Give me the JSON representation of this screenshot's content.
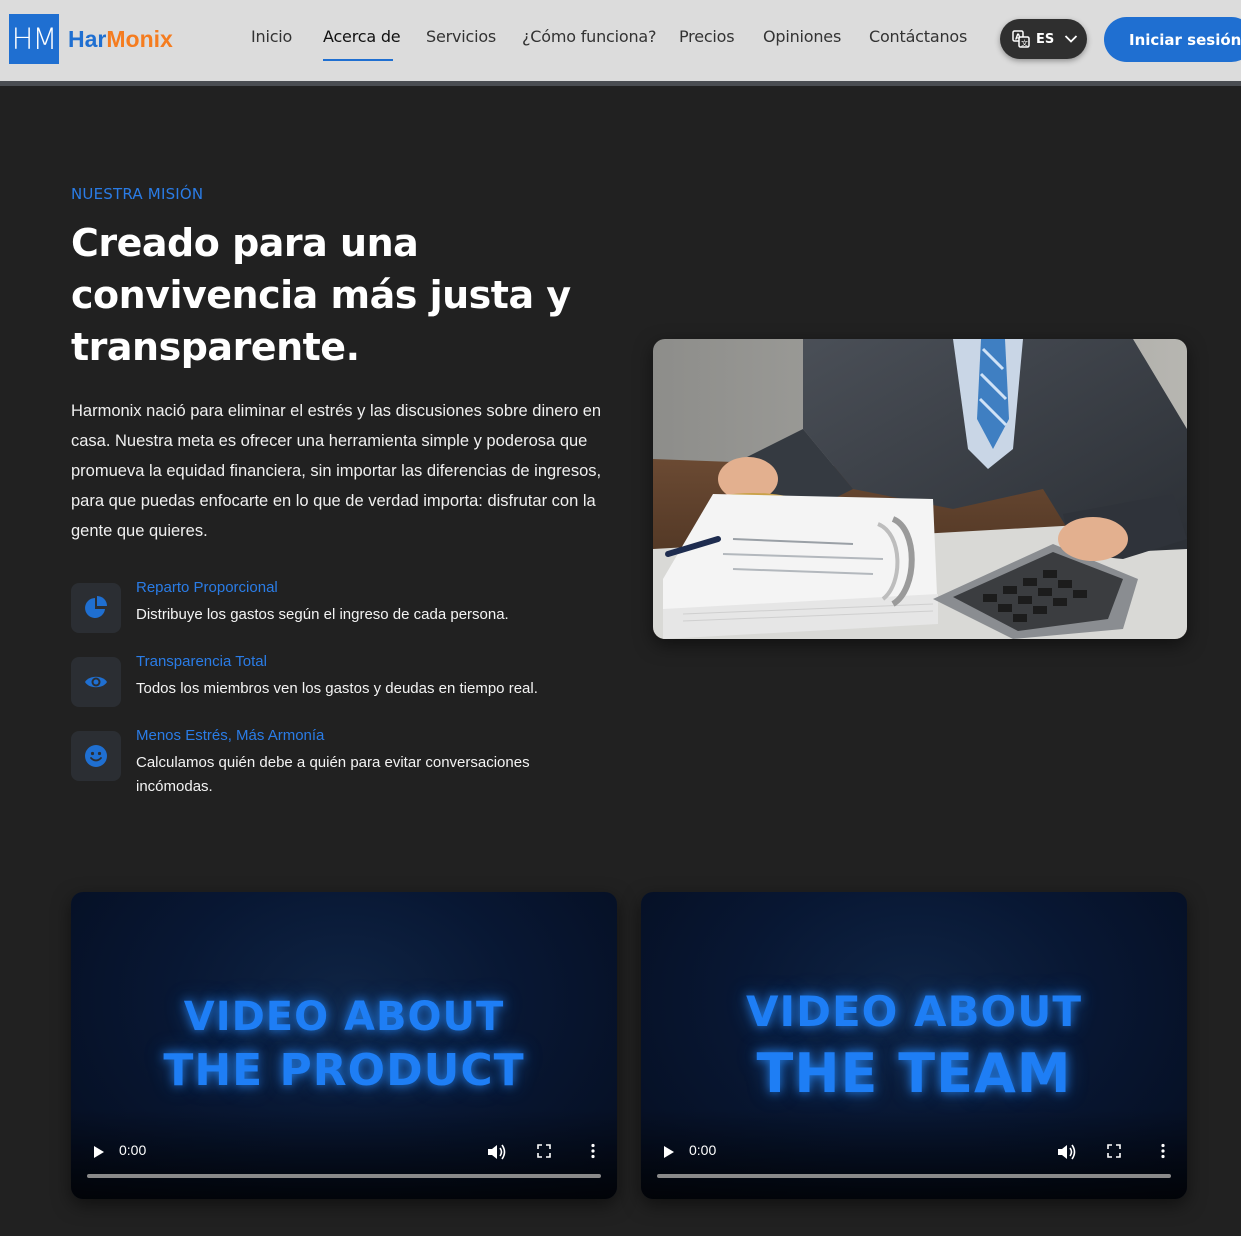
{
  "header": {
    "logo_mark": "HM",
    "brand_part1": "Har",
    "brand_part2": "Monix",
    "nav": [
      {
        "label": "Inicio"
      },
      {
        "label": "Acerca de",
        "active": true
      },
      {
        "label": "Servicios"
      },
      {
        "label": "¿Cómo funciona?"
      },
      {
        "label": "Precios"
      },
      {
        "label": "Opiniones"
      },
      {
        "label": "Contáctanos"
      }
    ],
    "language": "ES",
    "login_label": "Iniciar sesión"
  },
  "mission": {
    "kicker": "NUESTRA MISIÓN",
    "title_line1": "Creado para una",
    "title_line2": "convivencia más justa y",
    "title_line3": "transparente.",
    "description": "Harmonix nació para eliminar el estrés y las discusiones sobre dinero en casa. Nuestra meta es ofrecer una herramienta simple y poderosa que promueva la equidad financiera, sin importar las diferencias de ingresos, para que puedas enfocarte en lo que de verdad importa: disfrutar con la gente que quieres.",
    "features": [
      {
        "icon": "pie-chart-icon",
        "title": "Reparto Proporcional",
        "text": "Distribuye los gastos según el ingreso de cada persona."
      },
      {
        "icon": "eye-icon",
        "title": "Transparencia Total",
        "text": "Todos los miembros ven los gastos y deudas en tiempo real."
      },
      {
        "icon": "smiley-icon",
        "title": "Menos Estrés, Más Armonía",
        "text": "Calculamos quién debe a quién para evitar conversaciones incómodas."
      }
    ]
  },
  "videos": [
    {
      "line1": "VIDEO ABOUT",
      "line2": "THE PRODUCT",
      "time": "0:00"
    },
    {
      "line1": "VIDEO ABOUT",
      "line2": "THE TEAM",
      "time": "0:00"
    }
  ],
  "colors": {
    "accent": "#1f6fd1",
    "brand_orange": "#f57c1f",
    "background": "#212121",
    "header_bg": "#dcdcdc"
  }
}
